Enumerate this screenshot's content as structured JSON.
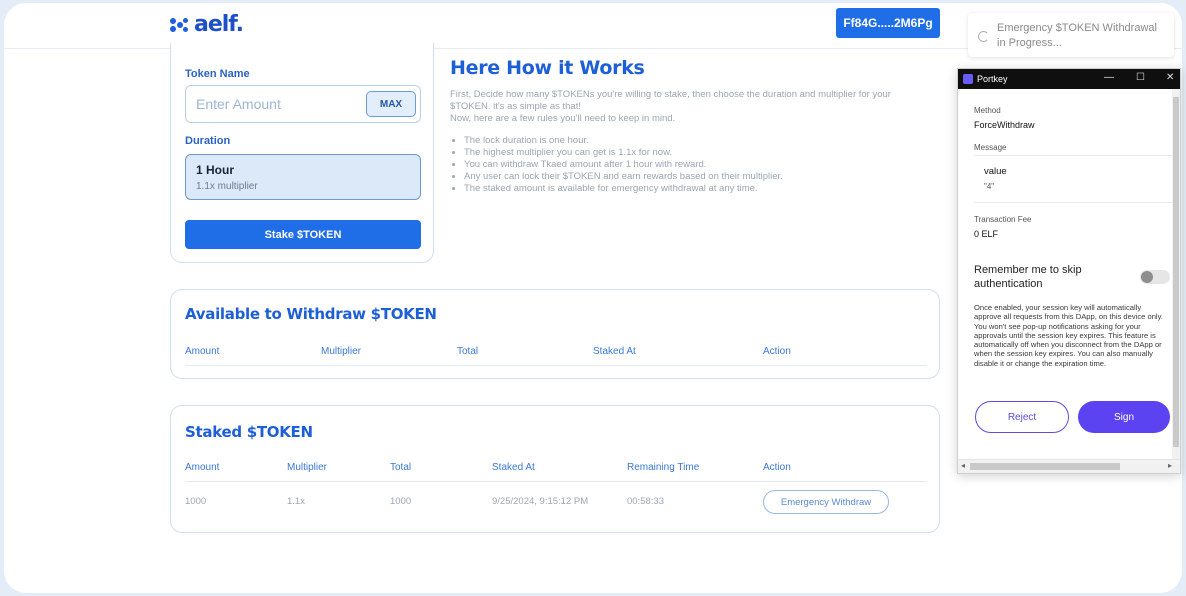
{
  "app": {
    "logo_text": "aelf.",
    "wallet_address": "Ff84G.....2M6Pg",
    "brand_color": "#1f6ee8"
  },
  "stake_form": {
    "token_label": "Token Name",
    "amount_placeholder": "Enter Amount",
    "max_label": "MAX",
    "duration_label": "Duration",
    "duration_value": "1 Hour",
    "duration_multiplier": "1.1x multiplier",
    "stake_button": "Stake $TOKEN"
  },
  "how_it_works": {
    "title": "Here How it Works",
    "intro_1": "First, Decide how many $TOKENs you're willing to stake, then choose the duration and multiplier for your $TOKEN. it's as simple as that!",
    "intro_2": "Now, here are a few rules you'll need to keep in mind.",
    "rules": [
      "The lock duration is one hour.",
      "The highest multiplier you can get is 1.1x for now.",
      "You can withdraw Tkaed amount after 1 hour with reward.",
      "Any user can lock their $TOKEN and earn rewards based on their multiplier.",
      "The staked amount is available for emergency withdrawal at any time."
    ]
  },
  "withdraw_table": {
    "title": "Available to Withdraw $TOKEN",
    "headers": [
      "Amount",
      "Multiplier",
      "Total",
      "Staked At",
      "Action"
    ]
  },
  "staked_table": {
    "title": "Staked $TOKEN",
    "headers": [
      "Amount",
      "Multiplier",
      "Total",
      "Staked At",
      "Remaining Time",
      "Action"
    ],
    "rows": [
      {
        "amount": "1000",
        "multiplier": "1.1x",
        "total": "1000",
        "staked_at": "9/25/2024, 9:15:12 PM",
        "remaining": "00:58:33",
        "action": "Emergency Withdraw"
      }
    ]
  },
  "toast": {
    "text": "Emergency $TOKEN Withdrawal in Progress..."
  },
  "portkey": {
    "window_title": "Portkey",
    "method_label": "Method",
    "method_value": "ForceWithdraw",
    "message_label": "Message",
    "message_key": "value",
    "message_value": "\"4\"",
    "fee_label": "Transaction Fee",
    "fee_value": "0 ELF",
    "remember_label": "Remember me to skip authentication",
    "remember_enabled": false,
    "description": "Once enabled, your session key will automatically approve all requests from this DApp, on this device only. You won't see pop-up notifications asking for your approvals until the session key expires. This feature is automatically off when you disconnect from the DApp or when the session key expires. You can also manually disable it or change the expiration time.",
    "reject_button": "Reject",
    "sign_button": "Sign",
    "accent_color": "#5b43f2"
  }
}
